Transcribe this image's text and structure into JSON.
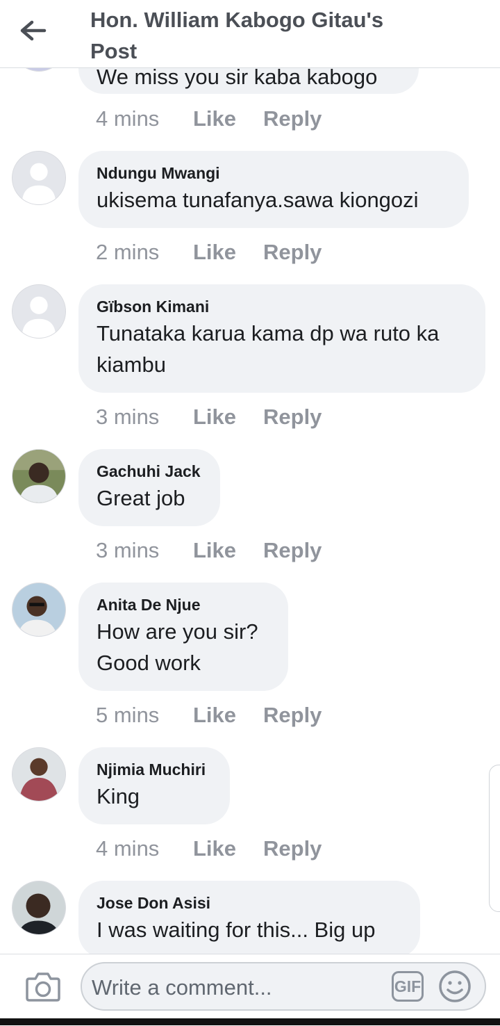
{
  "header": {
    "title_line1": "Hon. William Kabogo Gitau's",
    "title_line2": "Post"
  },
  "truncated_comment": {
    "text": "We miss you sir kaba kabogo",
    "time": "4 mins",
    "like": "Like",
    "reply": "Reply"
  },
  "comments": [
    {
      "name": "Ndungu Mwangi",
      "lines": [
        "ukisema tunafanya.sawa kiongozi"
      ],
      "time": "2 mins",
      "like": "Like",
      "reply": "Reply"
    },
    {
      "name": "Gïbson Kimani",
      "lines": [
        "Tunataka karua kama dp wa ruto ka",
        "kiambu"
      ],
      "time": "3 mins",
      "like": "Like",
      "reply": "Reply"
    },
    {
      "name": "Gachuhi Jack",
      "lines": [
        "Great job"
      ],
      "time": "3 mins",
      "like": "Like",
      "reply": "Reply"
    },
    {
      "name": "Anita De Njue",
      "lines": [
        "How are you sir?",
        "Good work"
      ],
      "time": "5 mins",
      "like": "Like",
      "reply": "Reply"
    },
    {
      "name": "Njimia Muchiri",
      "lines": [
        "King"
      ],
      "time": "4 mins",
      "like": "Like",
      "reply": "Reply"
    },
    {
      "name": "Jose Don Asisi",
      "lines": [
        "I was waiting for this... Big up"
      ]
    }
  ],
  "composer": {
    "placeholder": "Write a comment...",
    "gif_label": "GIF"
  },
  "icons": {
    "back": "arrow-left-icon",
    "camera": "camera-icon",
    "emoji": "smiley-icon"
  },
  "colors": {
    "muted_text": "#90949c",
    "bubble_bg": "#f0f2f5",
    "title": "#4b4f56"
  }
}
